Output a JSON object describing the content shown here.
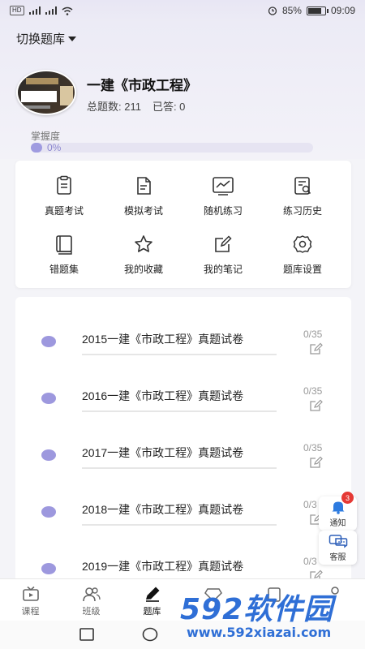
{
  "status_bar": {
    "left_text": "HD 4G 5G",
    "battery_pct_text": "85%",
    "battery_level": 0.85,
    "time": "09:09"
  },
  "header": {
    "switch_label": "切换题库"
  },
  "bank": {
    "title": "一建《市政工程》",
    "total_label": "总题数: 211",
    "answered_label": "已答: 0",
    "mastery_label": "掌握度",
    "mastery_pct_text": "0%",
    "mastery_value": 0
  },
  "menu": [
    {
      "label": "真题考试",
      "icon": "exam-paper-icon"
    },
    {
      "label": "模拟考试",
      "icon": "document-icon"
    },
    {
      "label": "随机练习",
      "icon": "chart-icon"
    },
    {
      "label": "练习历史",
      "icon": "history-search-icon"
    },
    {
      "label": "错题集",
      "icon": "book-icon"
    },
    {
      "label": "我的收藏",
      "icon": "star-icon"
    },
    {
      "label": "我的笔记",
      "icon": "note-edit-icon"
    },
    {
      "label": "题库设置",
      "icon": "settings-icon"
    }
  ],
  "papers": [
    {
      "title": "2015一建《市政工程》真题试卷",
      "progress": "0/35"
    },
    {
      "title": "2016一建《市政工程》真题试卷",
      "progress": "0/35"
    },
    {
      "title": "2017一建《市政工程》真题试卷",
      "progress": "0/35"
    },
    {
      "title": "2018一建《市政工程》真题试卷",
      "progress": "0/3"
    },
    {
      "title": "2019一建《市政工程》真题试卷",
      "progress": "0/3"
    }
  ],
  "floating": {
    "notify_label": "通知",
    "notify_count": "3",
    "service_label": "客服"
  },
  "bottom_nav": [
    {
      "label": "课程",
      "icon": "tv-icon"
    },
    {
      "label": "班级",
      "icon": "users-icon"
    },
    {
      "label": "题库",
      "icon": "pen-icon"
    }
  ],
  "watermark": {
    "big": "592软件园",
    "small": "www.592xiazai.com"
  },
  "colors": {
    "accent": "#9d98de",
    "watermark": "#2f6fd6"
  }
}
